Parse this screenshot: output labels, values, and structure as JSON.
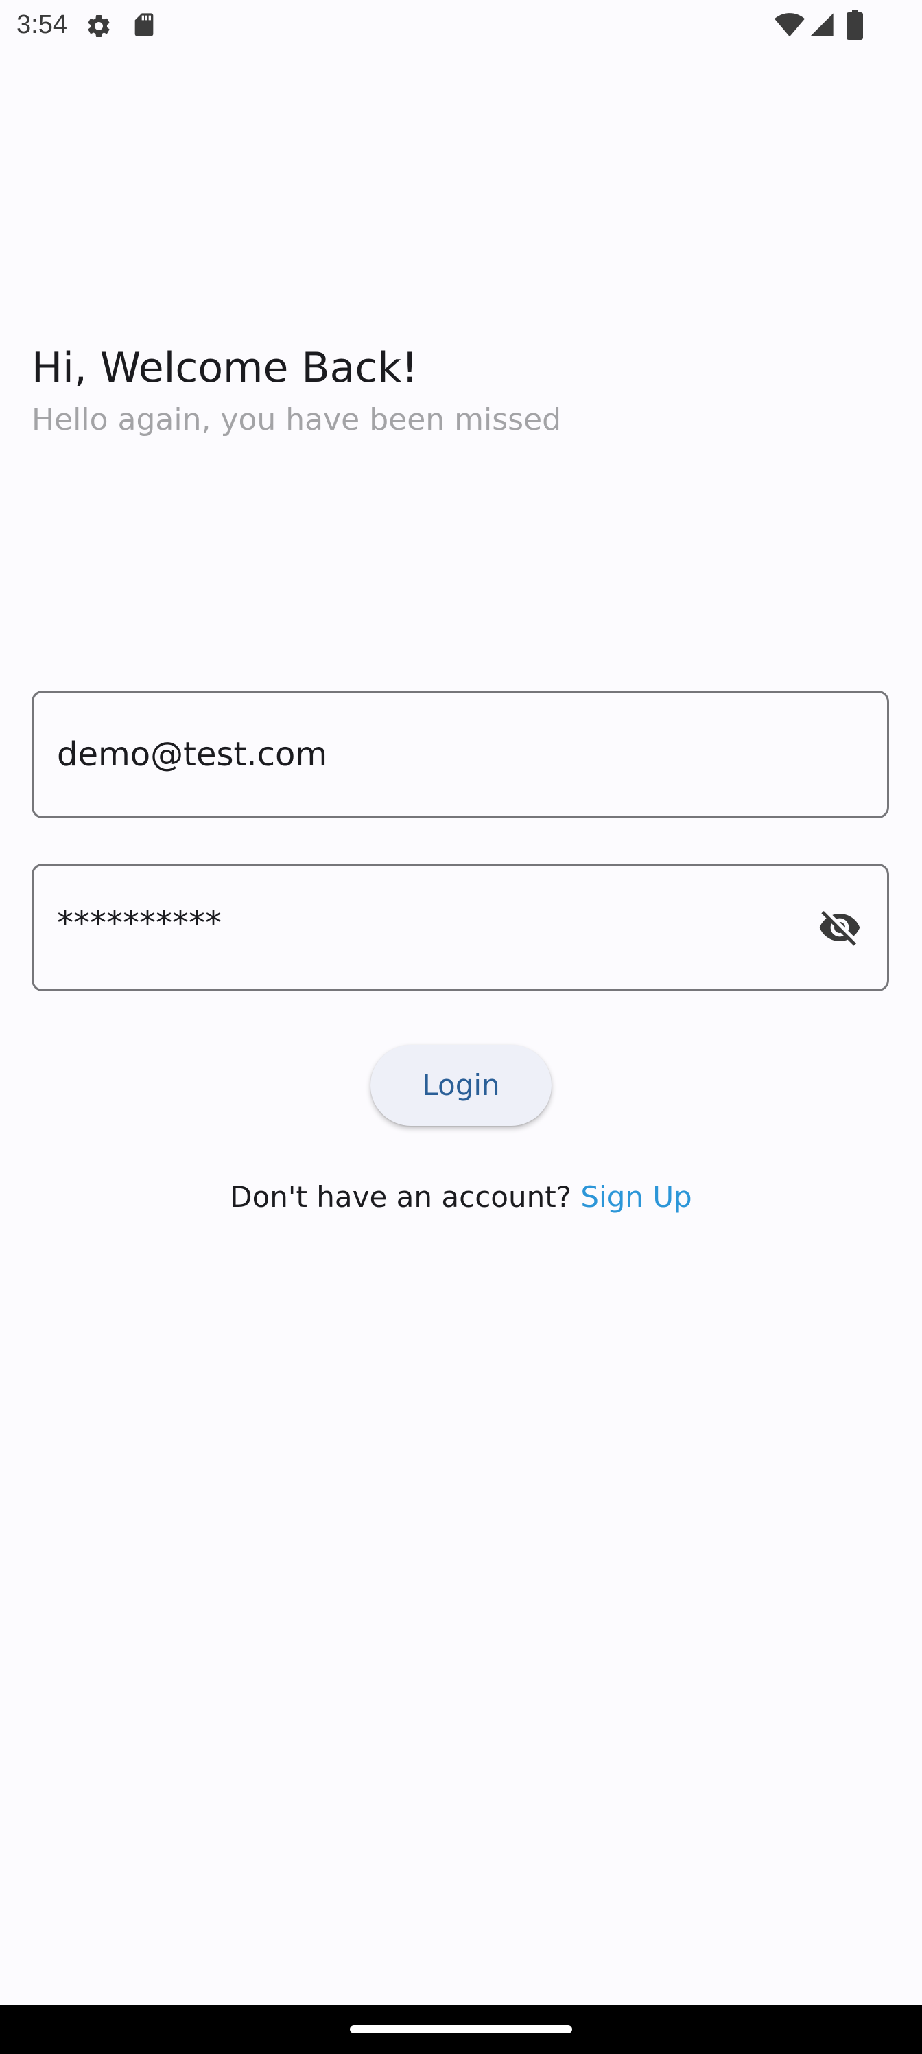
{
  "status_bar": {
    "time": "3:54",
    "icons": [
      "settings-icon",
      "sd-card-icon",
      "wifi-icon",
      "cell-signal-icon",
      "battery-icon"
    ]
  },
  "header": {
    "title": "Hi, Welcome Back!",
    "subtitle": "Hello again, you have been missed"
  },
  "form": {
    "email_value": "demo@test.com",
    "password_value": "**********",
    "password_visibility_icon": "eye-off-icon",
    "login_label": "Login"
  },
  "signup": {
    "prompt": "Don't have an account?",
    "link_label": "Sign Up"
  },
  "colors": {
    "background": "#fcfbfe",
    "accent_link": "#2c96d8",
    "button_text": "#2a5f97",
    "button_bg": "#eef0f8"
  }
}
